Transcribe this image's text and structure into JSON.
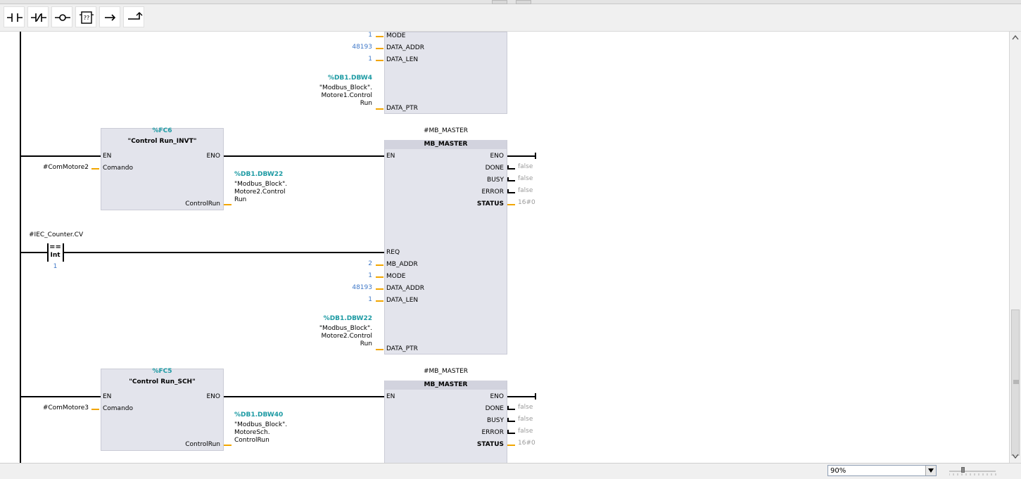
{
  "toolbar": {
    "buttons": [
      "normally-open-contact",
      "normally-closed-contact",
      "output-coil",
      "empty-box",
      "open-branch",
      "close-branch"
    ],
    "empty_box_glyph": "??"
  },
  "network_top": {
    "inputs": [
      {
        "value": "1",
        "pin": "MODE"
      },
      {
        "value": "48193",
        "pin": "DATA_ADDR"
      },
      {
        "value": "1",
        "pin": "DATA_LEN"
      }
    ],
    "ptr_addr": "%DB1.DBW4",
    "ptr_sym1": "\"Modbus_Block\".",
    "ptr_sym2": "Motore1.Control",
    "ptr_sym3": "Run",
    "ptr_pin": "DATA_PTR"
  },
  "network_mid": {
    "fc": {
      "addr": "%FC6",
      "name": "\"Control Run_INVT\"",
      "en": "EN",
      "eno": "ENO",
      "in_pin": "Comando",
      "in_val": "#ComMotore2",
      "out_pin": "ControlRun"
    },
    "out": {
      "addr": "%DB1.DBW22",
      "sym1": "\"Modbus_Block\".",
      "sym2": "Motore2.Control",
      "sym3": "Run"
    },
    "mb": {
      "instance": "#MB_MASTER",
      "title": "MB_MASTER",
      "en": "EN",
      "eno": "ENO",
      "outputs": [
        {
          "pin": "DONE",
          "value": "false"
        },
        {
          "pin": "BUSY",
          "value": "false"
        },
        {
          "pin": "ERROR",
          "value": "false"
        },
        {
          "pin": "STATUS",
          "value": "16#0"
        }
      ],
      "req": "REQ",
      "inputs": [
        {
          "value": "2",
          "pin": "MB_ADDR"
        },
        {
          "value": "1",
          "pin": "MODE"
        },
        {
          "value": "48193",
          "pin": "DATA_ADDR"
        },
        {
          "value": "1",
          "pin": "DATA_LEN"
        }
      ],
      "ptr_addr": "%DB1.DBW22",
      "ptr_sym1": "\"Modbus_Block\".",
      "ptr_sym2": "Motore2.Control",
      "ptr_sym3": "Run",
      "ptr_pin": "DATA_PTR"
    },
    "compare": {
      "operand": "#IEC_Counter.CV",
      "op": "==",
      "type": "Int",
      "value": "1"
    }
  },
  "network_bot": {
    "fc": {
      "addr": "%FC5",
      "name": "\"Control Run_SCH\"",
      "en": "EN",
      "eno": "ENO",
      "in_pin": "Comando",
      "in_val": "#ComMotore3",
      "out_pin": "ControlRun"
    },
    "out": {
      "addr": "%DB1.DBW40",
      "sym1": "\"Modbus_Block\".",
      "sym2": "MotoreSch.",
      "sym3": "ControlRun"
    },
    "mb": {
      "instance": "#MB_MASTER",
      "title": "MB_MASTER",
      "en": "EN",
      "eno": "ENO",
      "outputs": [
        {
          "pin": "DONE",
          "value": "false"
        },
        {
          "pin": "BUSY",
          "value": "false"
        },
        {
          "pin": "ERROR",
          "value": "false"
        },
        {
          "pin": "STATUS",
          "value": "16#0"
        }
      ]
    }
  },
  "statusbar": {
    "zoom": "90%"
  },
  "colors": {
    "accent_teal": "#1c9aa3",
    "constant_blue": "#3f78c8",
    "pin_orange": "#f2a600",
    "block_fill": "#e3e4ec"
  }
}
